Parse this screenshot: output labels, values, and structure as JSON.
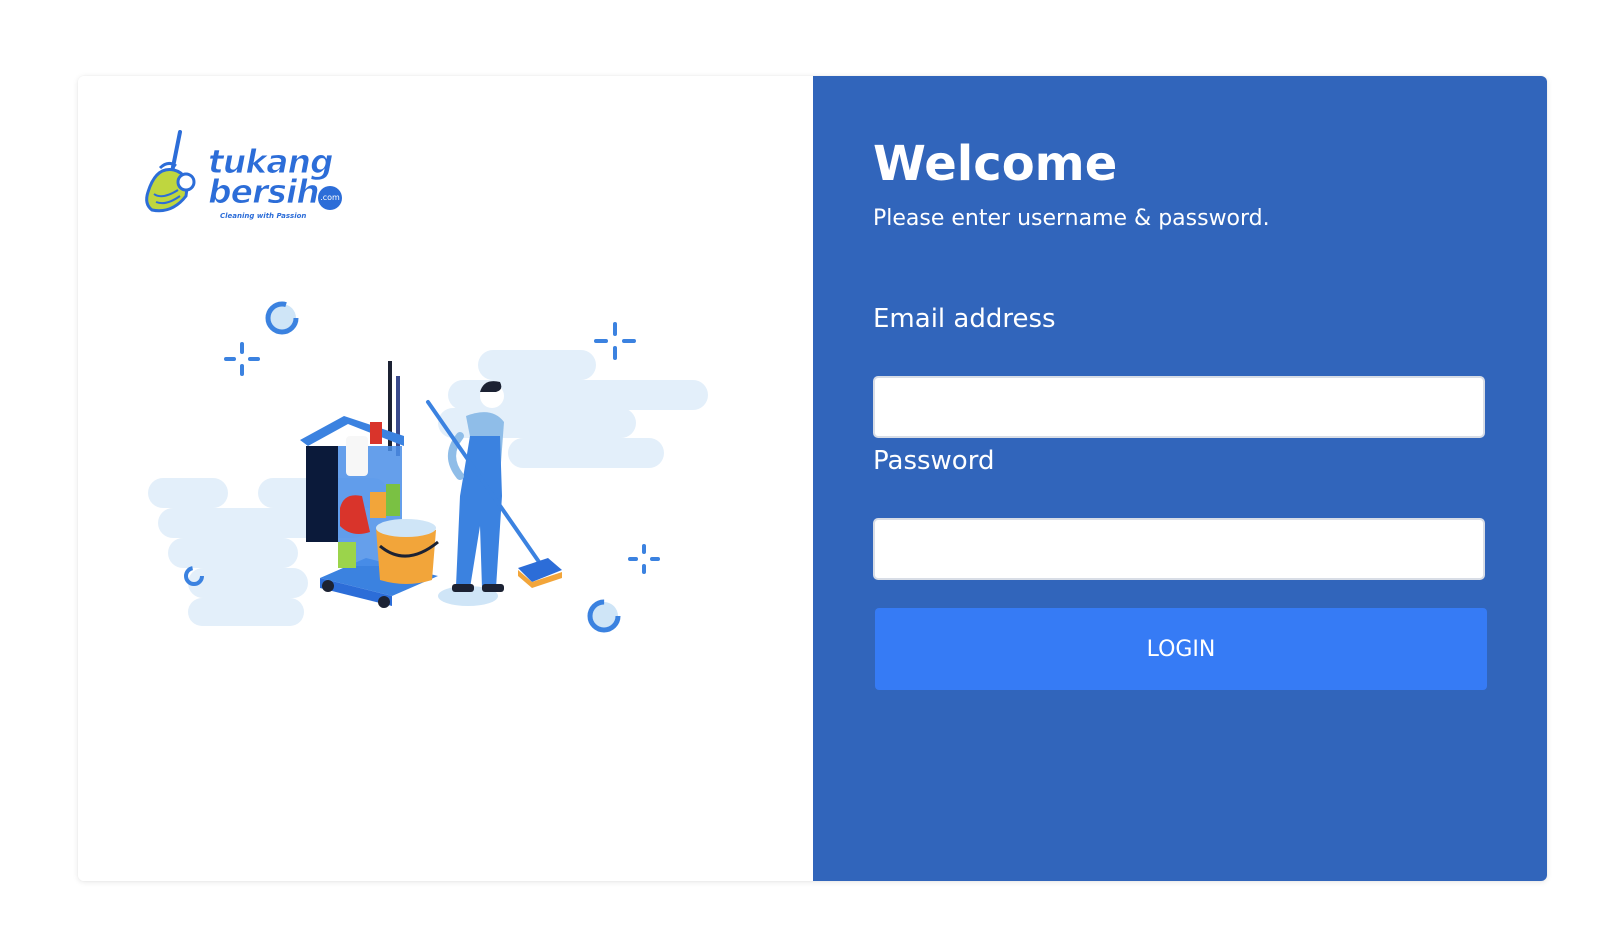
{
  "brand": {
    "name_line1": "tukang",
    "name_line2": "bersih",
    "domain_suffix": ".com",
    "tagline": "Cleaning with Passion"
  },
  "login": {
    "heading": "Welcome",
    "subtitle": "Please enter username & password.",
    "email_label": "Email address",
    "email_value": "",
    "password_label": "Password",
    "password_value": "",
    "submit_label": "LOGIN"
  },
  "colors": {
    "panel_background": "#3165bb",
    "button_background": "#367bf5",
    "brand_blue": "#2c6dd8",
    "illustration_accent": "#3b82e0",
    "cloud_background": "#e3effa"
  },
  "illustration": {
    "subject": "janitor-with-mop-and-cleaning-cart"
  }
}
